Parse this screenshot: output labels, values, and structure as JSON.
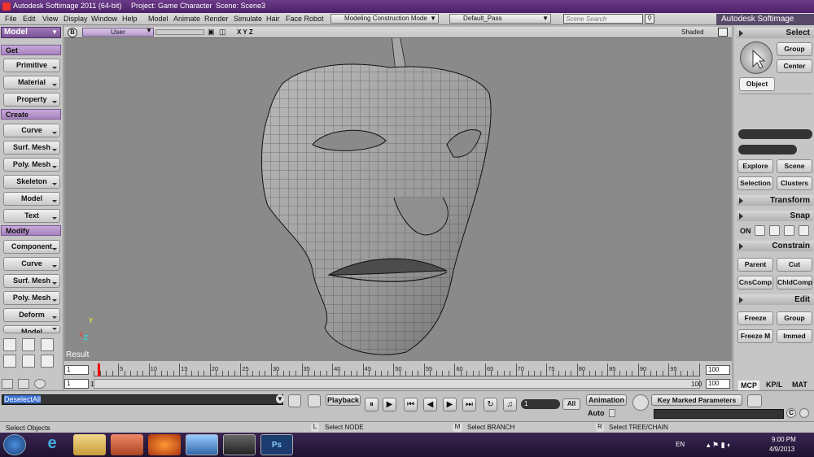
{
  "titlebar": {
    "app": "Autodesk Softimage 2011 (64-bit)",
    "project": "Project: Game Character",
    "scene": "Scene: Scene3"
  },
  "menubar": {
    "items": [
      "File",
      "Edit",
      "View",
      "Display",
      "Window",
      "Help",
      "Model",
      "Animate",
      "Render",
      "Simulate",
      "Hair",
      "Face Robot"
    ],
    "construction_mode": "Modeling Construction Mode",
    "pass": "Default_Pass",
    "scene_search_placeholder": "Scene Search",
    "brand": "Autodesk Softimage"
  },
  "left_panel": {
    "module": "Model",
    "sections": [
      {
        "header": "Get",
        "buttons": [
          "Primitive",
          "Material",
          "Property"
        ]
      },
      {
        "header": "Create",
        "buttons": [
          "Curve",
          "Surf. Mesh",
          "Poly. Mesh",
          "Skeleton",
          "Model",
          "Text"
        ]
      },
      {
        "header": "Modify",
        "buttons": [
          "Component",
          "Curve",
          "Surf. Mesh",
          "Poly. Mesh",
          "Deform",
          "Model"
        ]
      }
    ]
  },
  "viewport": {
    "letter": "B",
    "camera": "User",
    "axes": "X Y Z",
    "mode": "Shaded",
    "result_label": "Result",
    "axis_labels": {
      "y": "Y",
      "x": "X",
      "z": "Z"
    }
  },
  "right_panel": {
    "select_header": "Select",
    "group": "Group",
    "center": "Center",
    "object": "Object",
    "explore": "Explore",
    "scene": "Scene",
    "selection": "Selection",
    "clusters": "Clusters",
    "transform": "Transform",
    "snap": "Snap",
    "snap_on": "ON",
    "constrain": "Constrain",
    "parent": "Parent",
    "cut": "Cut",
    "cnscomp": "CnsComp",
    "chldcomp": "ChldComp",
    "edit": "Edit",
    "freeze": "Freeze",
    "edit_group": "Group",
    "freezem": "Freeze M",
    "immed": "Immed",
    "tabs": [
      "MCP",
      "KP/L",
      "MAT"
    ]
  },
  "timeline": {
    "start": "1",
    "start2": "1",
    "end": "100",
    "end2": "100",
    "end_label": "100",
    "ticks": [
      5,
      10,
      15,
      20,
      25,
      30,
      35,
      40,
      45,
      50,
      55,
      60,
      65,
      70,
      75,
      80,
      85,
      90,
      95
    ]
  },
  "playback": {
    "command": "DeselectAll",
    "playback_label": "Playback",
    "frame": "1",
    "all": "All",
    "animation_label": "Animation",
    "auto": "Auto",
    "key_marked": "Key Marked Parameters"
  },
  "statusbar": {
    "left": "Select Objects",
    "l_key": "L",
    "l_text": "Select NODE",
    "m_key": "M",
    "m_text": "Select BRANCH",
    "r_key": "R",
    "r_text": "Select TREE/CHAIN"
  },
  "taskbar": {
    "lang": "EN",
    "time": "9:00 PM",
    "date": "4/9/2013",
    "ps": "Ps"
  }
}
